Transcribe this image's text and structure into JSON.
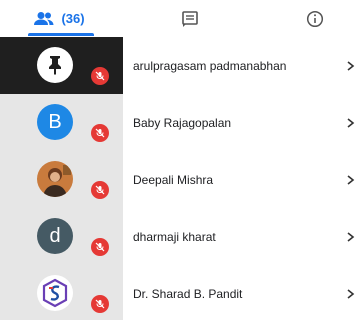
{
  "tabs": {
    "people_count": "(36)",
    "chat_icon": "chat-icon",
    "info_icon": "info-icon"
  },
  "colors": {
    "accent": "#1a73e8",
    "mute": "#e53935",
    "avatar_b": "#1e88e5",
    "avatar_d": "#455a64"
  },
  "participants": [
    {
      "name": "arulpragasam padmanabhan",
      "avatar": "pin-icon"
    },
    {
      "name": "Baby Rajagopalan",
      "avatar": "B"
    },
    {
      "name": "Deepali Mishra",
      "avatar": "photo"
    },
    {
      "name": "dharmaji kharat",
      "avatar": "d"
    },
    {
      "name": "Dr. Sharad B. Pandit",
      "avatar": "logo"
    }
  ]
}
